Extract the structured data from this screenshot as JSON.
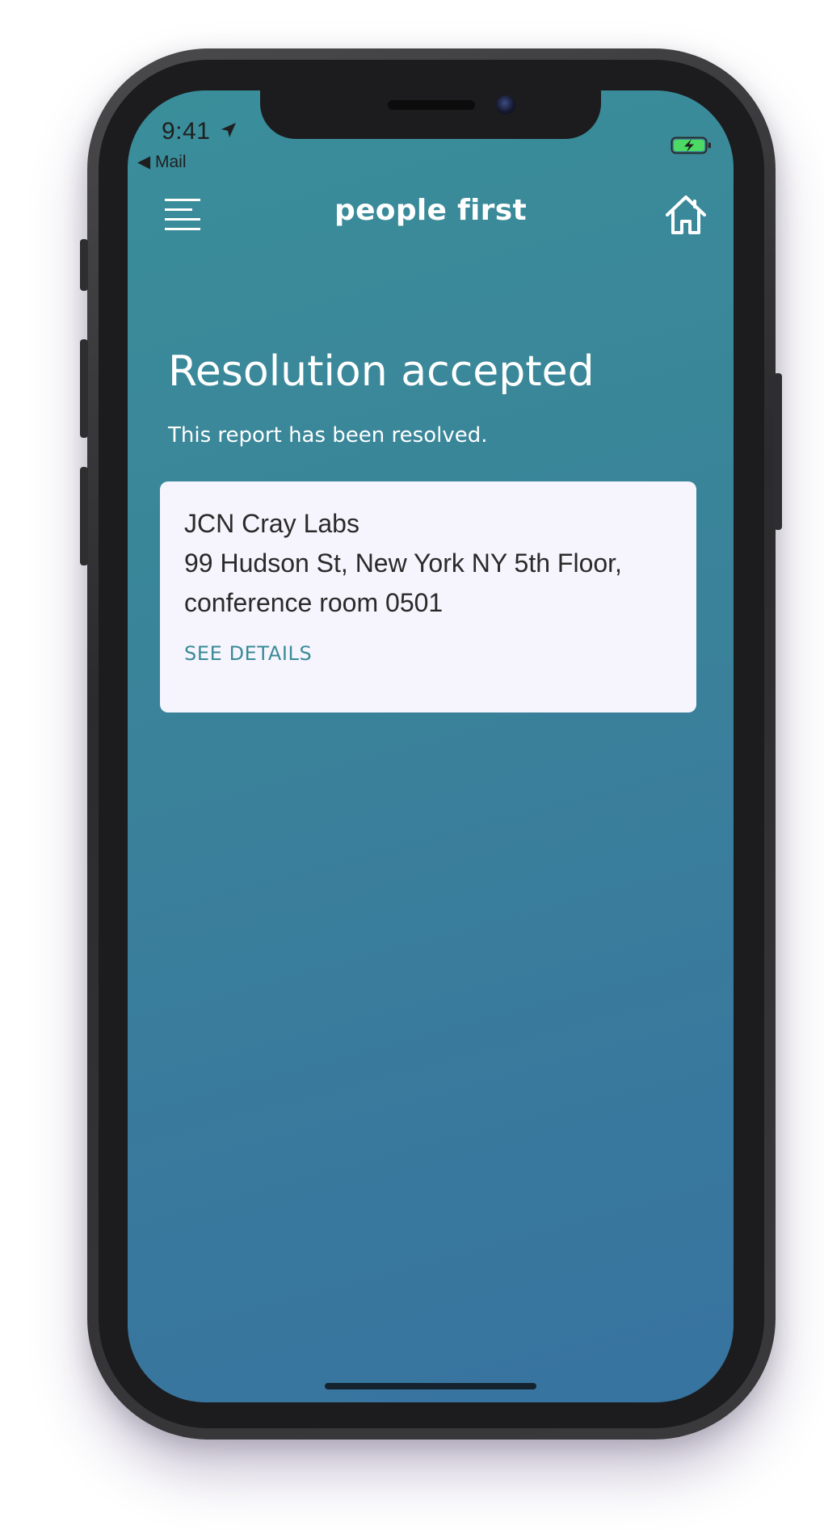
{
  "status_bar": {
    "time": "9:41",
    "back_label": "◀ Mail",
    "location_icon": "location-arrow-icon",
    "battery_icon": "battery-charging-icon"
  },
  "nav": {
    "title": "people first",
    "menu_icon": "hamburger-menu-icon",
    "home_icon": "home-icon"
  },
  "main": {
    "heading": "Resolution accepted",
    "subtext": "This report has been resolved."
  },
  "card": {
    "name": "JCN Cray Labs",
    "address": "99 Hudson St, New York NY 5th Floor, conference room 0501",
    "link_label": "SEE DETAILS"
  },
  "colors": {
    "gradient_top": "#3a8e9a",
    "gradient_bottom": "#3773a0",
    "card_background": "#f6f5fd",
    "link_color": "#3a8a98",
    "battery_fill": "#4cd964"
  }
}
